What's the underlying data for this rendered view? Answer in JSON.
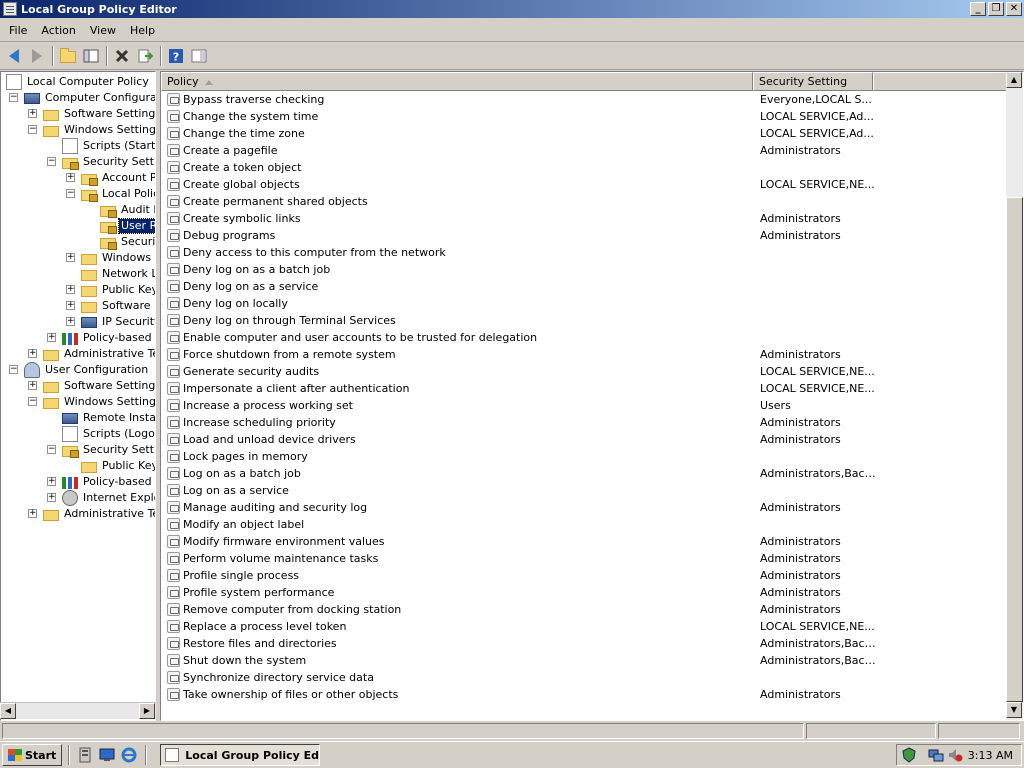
{
  "window": {
    "title": "Local Group Policy Editor"
  },
  "menu": [
    "File",
    "Action",
    "View",
    "Help"
  ],
  "tree": {
    "items": [
      {
        "label": "Local Computer Policy"
      },
      {
        "label": "Computer Configuration"
      },
      {
        "label": "Software Settings"
      },
      {
        "label": "Windows Settings"
      },
      {
        "label": "Scripts (Startup/Shutdown)"
      },
      {
        "label": "Security Settings"
      },
      {
        "label": "Account Policies"
      },
      {
        "label": "Local Policies"
      },
      {
        "label": "Audit Policy"
      },
      {
        "label": "User Rights Assignment"
      },
      {
        "label": "Security Options"
      },
      {
        "label": "Windows Firewall with Advanced Security"
      },
      {
        "label": "Network List Manager Policies"
      },
      {
        "label": "Public Key Policies"
      },
      {
        "label": "Software Restriction Policies"
      },
      {
        "label": "IP Security Policies on Local Computer"
      },
      {
        "label": "Policy-based QoS"
      },
      {
        "label": "Administrative Templates"
      },
      {
        "label": "User Configuration"
      },
      {
        "label": "Software Settings"
      },
      {
        "label": "Windows Settings"
      },
      {
        "label": "Remote Installation Services"
      },
      {
        "label": "Scripts (Logon/Logoff)"
      },
      {
        "label": "Security Settings"
      },
      {
        "label": "Public Key Policies"
      },
      {
        "label": "Policy-based QoS"
      },
      {
        "label": "Internet Explorer Maintenance"
      },
      {
        "label": "Administrative Templates"
      }
    ]
  },
  "list": {
    "columns": [
      "Policy",
      "Security Setting"
    ],
    "rows": [
      {
        "policy": "Bypass traverse checking",
        "setting": "Everyone,LOCAL S..."
      },
      {
        "policy": "Change the system time",
        "setting": "LOCAL SERVICE,Ad..."
      },
      {
        "policy": "Change the time zone",
        "setting": "LOCAL SERVICE,Ad..."
      },
      {
        "policy": "Create a pagefile",
        "setting": "Administrators"
      },
      {
        "policy": "Create a token object",
        "setting": ""
      },
      {
        "policy": "Create global objects",
        "setting": "LOCAL SERVICE,NE..."
      },
      {
        "policy": "Create permanent shared objects",
        "setting": ""
      },
      {
        "policy": "Create symbolic links",
        "setting": "Administrators"
      },
      {
        "policy": "Debug programs",
        "setting": "Administrators"
      },
      {
        "policy": "Deny access to this computer from the network",
        "setting": ""
      },
      {
        "policy": "Deny log on as a batch job",
        "setting": ""
      },
      {
        "policy": "Deny log on as a service",
        "setting": ""
      },
      {
        "policy": "Deny log on locally",
        "setting": ""
      },
      {
        "policy": "Deny log on through Terminal Services",
        "setting": ""
      },
      {
        "policy": "Enable computer and user accounts to be trusted for delegation",
        "setting": ""
      },
      {
        "policy": "Force shutdown from a remote system",
        "setting": "Administrators"
      },
      {
        "policy": "Generate security audits",
        "setting": "LOCAL SERVICE,NE..."
      },
      {
        "policy": "Impersonate a client after authentication",
        "setting": "LOCAL SERVICE,NE..."
      },
      {
        "policy": "Increase a process working set",
        "setting": "Users"
      },
      {
        "policy": "Increase scheduling priority",
        "setting": "Administrators"
      },
      {
        "policy": "Load and unload device drivers",
        "setting": "Administrators"
      },
      {
        "policy": "Lock pages in memory",
        "setting": ""
      },
      {
        "policy": "Log on as a batch job",
        "setting": "Administrators,Back..."
      },
      {
        "policy": "Log on as a service",
        "setting": ""
      },
      {
        "policy": "Manage auditing and security log",
        "setting": "Administrators"
      },
      {
        "policy": "Modify an object label",
        "setting": ""
      },
      {
        "policy": "Modify firmware environment values",
        "setting": "Administrators"
      },
      {
        "policy": "Perform volume maintenance tasks",
        "setting": "Administrators"
      },
      {
        "policy": "Profile single process",
        "setting": "Administrators"
      },
      {
        "policy": "Profile system performance",
        "setting": "Administrators"
      },
      {
        "policy": "Remove computer from docking station",
        "setting": "Administrators"
      },
      {
        "policy": "Replace a process level token",
        "setting": "LOCAL SERVICE,NE..."
      },
      {
        "policy": "Restore files and directories",
        "setting": "Administrators,Back..."
      },
      {
        "policy": "Shut down the system",
        "setting": "Administrators,Back..."
      },
      {
        "policy": "Synchronize directory service data",
        "setting": ""
      },
      {
        "policy": "Take ownership of files or other objects",
        "setting": "Administrators"
      }
    ]
  },
  "taskbar": {
    "start_label": "Start",
    "task_label": "Local Group Policy Edi...",
    "clock": "3:13 AM"
  }
}
